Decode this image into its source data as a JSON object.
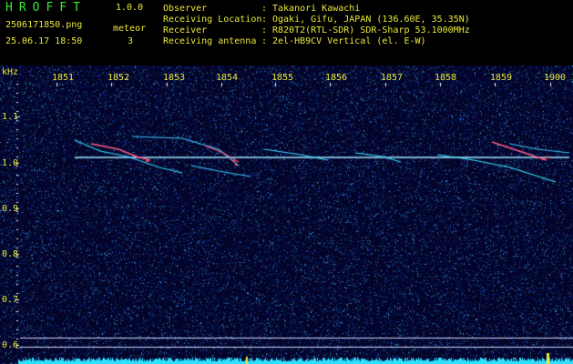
{
  "app": {
    "title": "HROFFT",
    "version": "1.0.0"
  },
  "file": {
    "name": "2506171850.png",
    "timestamp": "25.06.17 18:50"
  },
  "meteor": {
    "label": "meteor",
    "count": "3"
  },
  "info": [
    {
      "label": "Observer",
      "value": "Takanori Kawachi"
    },
    {
      "label": "Receiving Location",
      "value": "Ogaki, Gifu, JAPAN (136.60E, 35.35N)"
    },
    {
      "label": "Receiver",
      "value": "R820T2(RTL-SDR) SDR-Sharp 53.1000MHz"
    },
    {
      "label": "Receiving antenna",
      "value": "2el-HB9CV Vertical (el. E-W)"
    }
  ],
  "axis": {
    "unit": "kHz",
    "y_ticks": [
      "1.1",
      "1.0",
      "0.9",
      "0.8",
      "0.7",
      "0.6"
    ],
    "x_ticks": [
      "1851",
      "1852",
      "1853",
      "1854",
      "1855",
      "1856",
      "1857",
      "1858",
      "1859",
      "1900"
    ]
  },
  "colors": {
    "background": "#04042a",
    "text": "#e8e83a",
    "title": "#38e838",
    "carrier": "#9ee8ff",
    "noise": "#2ee0ff"
  }
}
